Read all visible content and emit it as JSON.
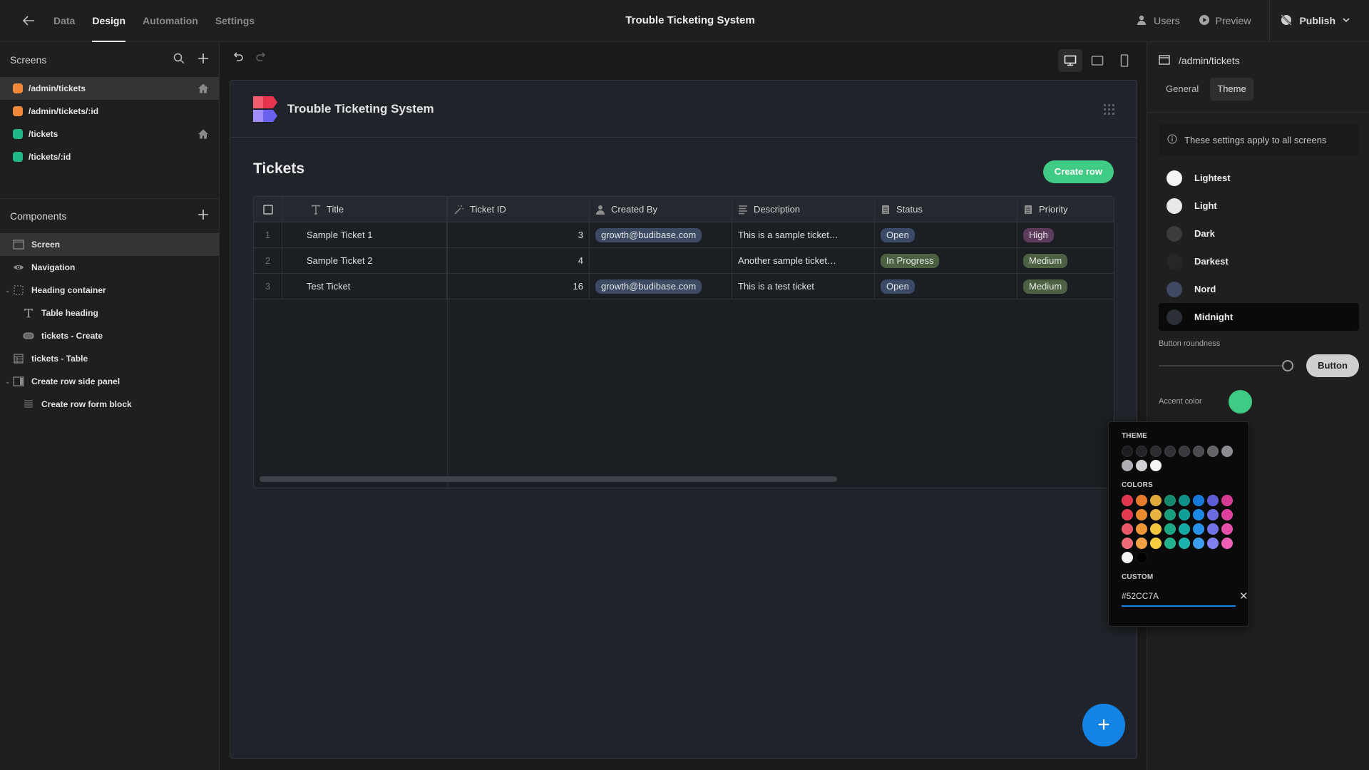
{
  "topbar": {
    "tabs": [
      "Data",
      "Design",
      "Automation",
      "Settings"
    ],
    "active_tab": "Design",
    "app_title": "Trouble Ticketing System",
    "users_label": "Users",
    "preview_label": "Preview",
    "publish_label": "Publish"
  },
  "sidebar": {
    "screens_title": "Screens",
    "screens": [
      {
        "route": "/admin/tickets",
        "color": "#f08a3a",
        "home": true,
        "selected": true
      },
      {
        "route": "/admin/tickets/:id",
        "color": "#f08a3a",
        "home": false,
        "selected": false
      },
      {
        "route": "/tickets",
        "color": "#20b888",
        "home": true,
        "selected": false
      },
      {
        "route": "/tickets/:id",
        "color": "#20b888",
        "home": false,
        "selected": false
      }
    ],
    "components_title": "Components",
    "components": [
      {
        "label": "Screen",
        "icon": "screen-icon",
        "level": 0,
        "selected": true
      },
      {
        "label": "Navigation",
        "icon": "eye-icon",
        "level": 0
      },
      {
        "label": "Heading container",
        "icon": "container-icon",
        "level": 0,
        "expanded": true
      },
      {
        "label": "Table heading",
        "icon": "text-icon",
        "level": 1
      },
      {
        "label": "tickets - Create",
        "icon": "button-icon",
        "level": 1
      },
      {
        "label": "tickets - Table",
        "icon": "table-icon",
        "level": 0
      },
      {
        "label": "Create row side panel",
        "icon": "side-panel-icon",
        "level": 0,
        "expanded": true
      },
      {
        "label": "Create row form block",
        "icon": "form-icon",
        "level": 1
      }
    ]
  },
  "canvas": {
    "app_name": "Trouble Ticketing System",
    "heading": "Tickets",
    "create_row_label": "Create row",
    "table": {
      "columns": [
        {
          "label": "Title",
          "icon": "text-icon"
        },
        {
          "label": "Ticket ID",
          "icon": "magic-wand-icon"
        },
        {
          "label": "Created By",
          "icon": "user-icon"
        },
        {
          "label": "Description",
          "icon": "long-text-icon"
        },
        {
          "label": "Status",
          "icon": "options-icon"
        },
        {
          "label": "Priority",
          "icon": "options-icon"
        }
      ],
      "rows": [
        {
          "num": "1",
          "title": "Sample Ticket 1",
          "id": "3",
          "created_by": "growth@budibase.com",
          "description": "This is a sample ticket…",
          "status": "Open",
          "priority": "High"
        },
        {
          "num": "2",
          "title": "Sample Ticket 2",
          "id": "4",
          "created_by": "",
          "description": "Another sample ticket…",
          "status": "In Progress",
          "priority": "Medium"
        },
        {
          "num": "3",
          "title": "Test Ticket",
          "id": "16",
          "created_by": "growth@budibase.com",
          "description": "This is a test ticket",
          "status": "Open",
          "priority": "Medium"
        }
      ],
      "pill_colors": {
        "user": "#3d4a63",
        "Open": "#3b4a66",
        "In Progress": "#4c6141",
        "High": "#5c3b5c",
        "Medium": "#4c6141"
      }
    }
  },
  "right_panel": {
    "screen_route": "/admin/tickets",
    "tabs": [
      "General",
      "Theme"
    ],
    "active_tab": "Theme",
    "info_text": "These settings apply to all screens",
    "themes": [
      {
        "label": "Lightest",
        "color": "#f5f5f5"
      },
      {
        "label": "Light",
        "color": "#e8e8e8"
      },
      {
        "label": "Dark",
        "color": "#3c3c3c"
      },
      {
        "label": "Darkest",
        "color": "#262626"
      },
      {
        "label": "Nord",
        "color": "#3f4a62"
      },
      {
        "label": "Midnight",
        "color": "#2a2f38",
        "selected": true
      }
    ],
    "button_roundness_label": "Button roundness",
    "button_roundness_value": 1.0,
    "button_preview_label": "Button",
    "accent_color_label": "Accent color",
    "accent_color": "#3fcb83"
  },
  "color_picker": {
    "theme_title": "THEME",
    "theme_colors": [
      "#1c1d20",
      "#232428",
      "#2a2c31",
      "#303237",
      "#383a40",
      "#4a4c52",
      "#62646a",
      "#8a8c92",
      "#acaeb4",
      "#d0d2d6",
      "#f4f4f4"
    ],
    "colors_title": "COLORS",
    "colors": [
      "#e0354f",
      "#e47a2a",
      "#e0aa38",
      "#138a6e",
      "#0f9088",
      "#1479db",
      "#5c5cd6",
      "#d63a93",
      "#e3394f",
      "#ea8a2e",
      "#e6b33f",
      "#179c7c",
      "#10a09a",
      "#1887e6",
      "#6b6be0",
      "#df3e9e",
      "#ec566a",
      "#ef9634",
      "#f2c43c",
      "#1aa884",
      "#13aaa4",
      "#2590ea",
      "#7272e8",
      "#e64ca9",
      "#f06a79",
      "#f2a144",
      "#f7cf3e",
      "#20b28c",
      "#18b4ad",
      "#3b9df0",
      "#7f7ff0",
      "#ee5eb7",
      "#f4f4f4",
      "#000000"
    ],
    "custom_title": "CUSTOM",
    "custom_value": "#52CC7A"
  }
}
